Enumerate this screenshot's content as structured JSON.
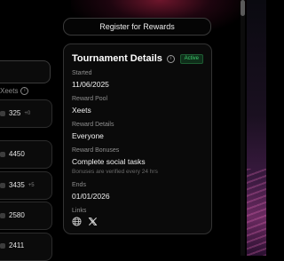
{
  "register_button": "Register for Rewards",
  "leaderboard": {
    "column_label": "Xeets",
    "rows": [
      {
        "value": "325",
        "delta": "+0"
      },
      {
        "value": "4450",
        "delta": ""
      },
      {
        "value": "3435",
        "delta": "+5"
      },
      {
        "value": "2580",
        "delta": ""
      },
      {
        "value": "2411",
        "delta": ""
      }
    ]
  },
  "details": {
    "title": "Tournament Details",
    "status": "Active",
    "started_label": "Started",
    "started_value": "11/06/2025",
    "pool_label": "Reward Pool",
    "pool_value": "Xeets",
    "reward_details_label": "Reward Details",
    "reward_details_value": "Everyone",
    "bonuses_label": "Reward Bonuses",
    "bonuses_value": "Complete social tasks",
    "bonuses_note": "Bonuses are verified every 24 hrs",
    "ends_label": "Ends",
    "ends_value": "01/01/2026",
    "links_label": "Links",
    "links": [
      {
        "icon": "globe-icon"
      },
      {
        "icon": "x-logo-icon"
      }
    ]
  },
  "colors": {
    "active_badge": "#3ecf6e",
    "background": "#000000"
  }
}
